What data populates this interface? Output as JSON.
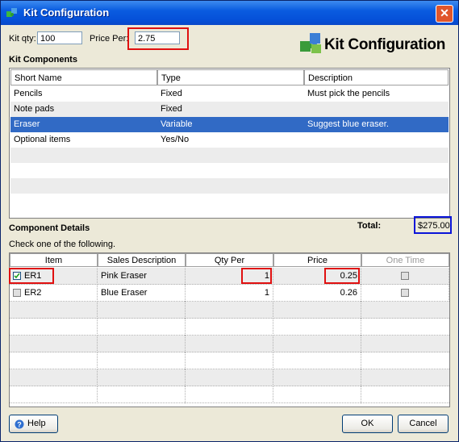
{
  "window": {
    "title": "Kit Configuration",
    "close_glyph": "✕"
  },
  "header": {
    "kit_qty_label": "Kit qty:",
    "kit_qty_value": "100",
    "price_per_label": "Price Per:",
    "price_per_value": "2.75",
    "brand_title": "Kit Configuration",
    "brand_icon": "puzzle-pieces-icon"
  },
  "kit_components": {
    "section_label": "Kit Components",
    "columns": [
      "Short Name",
      "Type",
      "Description"
    ],
    "rows": [
      {
        "name": "Pencils",
        "type": "Fixed",
        "description": "Must pick the pencils"
      },
      {
        "name": "Note pads",
        "type": "Fixed",
        "description": ""
      },
      {
        "name": "Eraser",
        "type": "Variable",
        "description": "Suggest blue eraser."
      },
      {
        "name": "Optional items",
        "type": "Yes/No",
        "description": ""
      }
    ],
    "selected_row": 2
  },
  "component_details": {
    "section_label": "Component Details",
    "total_label": "Total:",
    "total_value": "$275.00",
    "instruction": "Check one of the following.",
    "columns": [
      "Item",
      "Sales Description",
      "Qty Per",
      "Price",
      "One Time"
    ],
    "rows": [
      {
        "checked": true,
        "item": "ER1",
        "sales_description": "Pink Eraser",
        "qty_per": "1",
        "price": "0.25",
        "one_time": false
      },
      {
        "checked": false,
        "item": "ER2",
        "sales_description": "Blue Eraser",
        "qty_per": "1",
        "price": "0.26",
        "one_time": false
      }
    ]
  },
  "footer": {
    "help_label": "Help",
    "ok_label": "OK",
    "cancel_label": "Cancel"
  },
  "colors": {
    "title_bar": "#0a5ce0",
    "selection": "#316ac5",
    "highlight_red": "#e01010",
    "highlight_blue": "#0a14d8"
  }
}
